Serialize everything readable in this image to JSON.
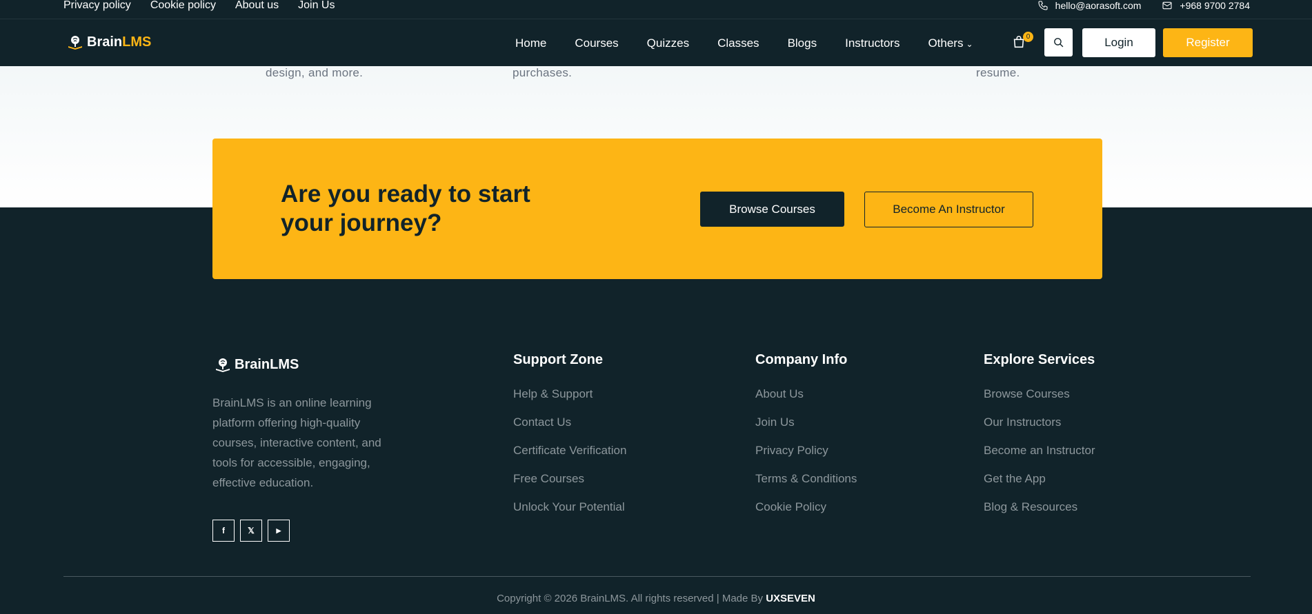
{
  "topbar": {
    "links": [
      "Privacy policy",
      "Cookie policy",
      "About us",
      "Join Us"
    ],
    "email": "hello@aorasoft.com",
    "phone": "+968 9700 2784"
  },
  "nav": {
    "logo_brain": "Brain",
    "logo_lms": "LMS",
    "items": [
      "Home",
      "Courses",
      "Quizzes",
      "Classes",
      "Blogs",
      "Instructors",
      "Others"
    ],
    "cart_count": "0",
    "login_label": "Login",
    "register_label": "Register"
  },
  "features": {
    "tails": [
      "design, and more.",
      "purchases.",
      "resume."
    ]
  },
  "cta": {
    "heading": "Are you ready to start your journey?",
    "browse_label": "Browse Courses",
    "instructor_label": "Become An Instructor"
  },
  "footer": {
    "brand": "BrainLMS",
    "description": "BrainLMS is an online learning platform offering high-quality courses, interactive content, and tools for accessible, engaging, effective education.",
    "socials": [
      "f",
      "𝕏",
      "▶"
    ],
    "columns": [
      {
        "title": "Support Zone",
        "links": [
          "Help & Support",
          "Contact Us",
          "Certificate Verification",
          "Free Courses",
          "Unlock Your Potential"
        ]
      },
      {
        "title": "Company Info",
        "links": [
          "About Us",
          "Join Us",
          "Privacy Policy",
          "Terms & Conditions",
          "Cookie Policy"
        ]
      },
      {
        "title": "Explore Services",
        "links": [
          "Browse Courses",
          "Our Instructors",
          "Become an Instructor",
          "Get the App",
          "Blog & Resources"
        ]
      }
    ],
    "copyright_text": "Copyright © 2026 BrainLMS. All rights reserved | Made By ",
    "copyright_maker": "UXSEVEN"
  },
  "colors": {
    "dark": "#11232a",
    "accent": "#fdb515",
    "muted_text": "#8d979c"
  }
}
